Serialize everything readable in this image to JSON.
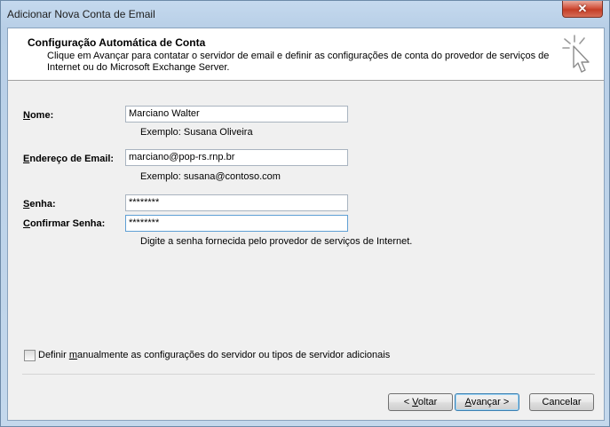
{
  "window": {
    "title": "Adicionar Nova Conta de Email",
    "close_label": "✕"
  },
  "header": {
    "title": "Configuração Automática de Conta",
    "description": "Clique em Avançar para contatar o servidor de email e definir as configurações de conta do provedor de serviços de Internet ou do Microsoft Exchange Server.",
    "icon": "cursor-sparkle-icon"
  },
  "form": {
    "name": {
      "label_u": "N",
      "label_rest": "ome:",
      "value": "Marciano Walter",
      "example": "Exemplo: Susana Oliveira"
    },
    "email": {
      "label_u": "E",
      "label_rest": "ndereço de Email:",
      "value": "marciano@pop-rs.rnp.br",
      "example": "Exemplo: susana@contoso.com"
    },
    "password": {
      "label_u": "S",
      "label_rest": "enha:",
      "value": "********"
    },
    "confirm": {
      "label_u": "C",
      "label_rest": "onfirmar Senha:",
      "value": "********",
      "hint": "Digite a senha fornecida pelo provedor de serviços de Internet."
    }
  },
  "manual": {
    "label_pre": "Definir ",
    "label_u": "m",
    "label_post": "anualmente as configurações do servidor ou tipos de servidor adicionais",
    "checked": false
  },
  "buttons": {
    "back": {
      "pre": "< ",
      "u": "V",
      "post": "oltar"
    },
    "next": {
      "u": "A",
      "post": "vançar >"
    },
    "cancel": "Cancelar"
  }
}
